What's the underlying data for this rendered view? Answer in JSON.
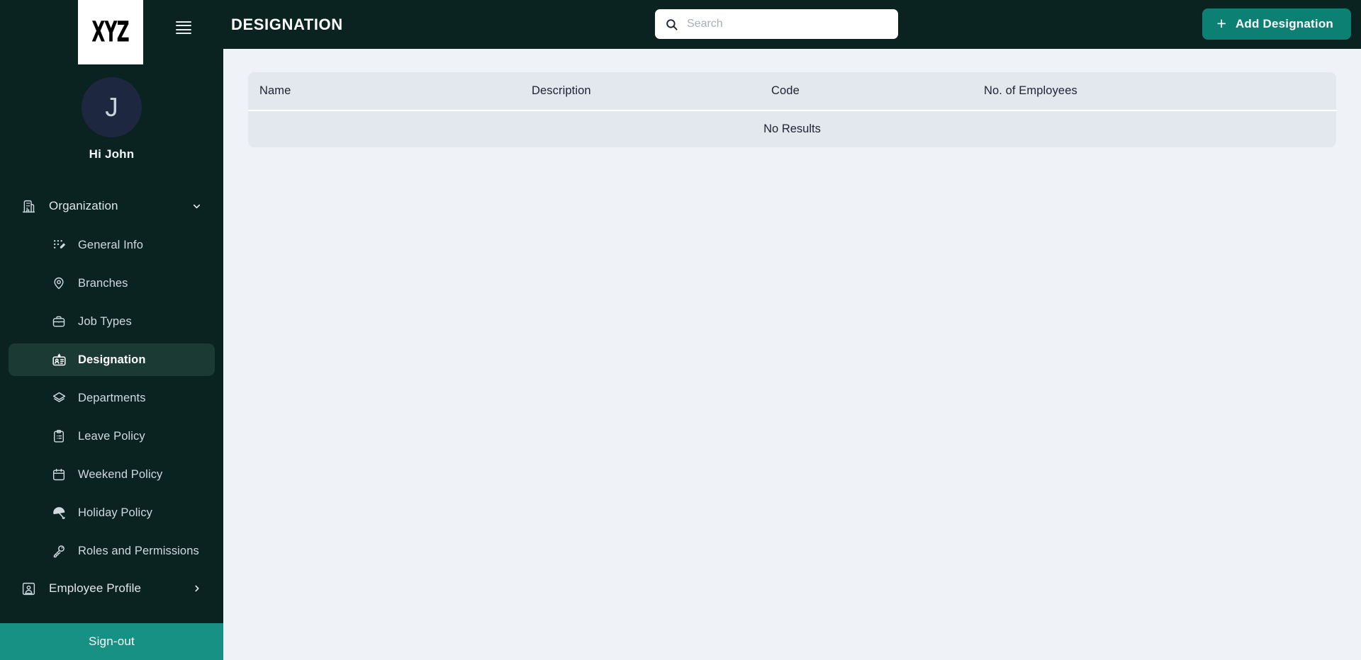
{
  "brand": {
    "logo_text": "XYZ",
    "menu_icon": "hamburger-icon"
  },
  "user": {
    "initial": "J",
    "greeting": "Hi John"
  },
  "sidebar": {
    "group": {
      "label": "Organization",
      "icon": "building-icon",
      "chevron": "chevron-down-icon",
      "expanded": true
    },
    "items": [
      {
        "label": "General Info",
        "icon": "dotted-grid-pencil-icon",
        "active": false
      },
      {
        "label": "Branches",
        "icon": "map-pin-icon",
        "active": false
      },
      {
        "label": "Job Types",
        "icon": "briefcase-icon",
        "active": false
      },
      {
        "label": "Designation",
        "icon": "id-badge-icon",
        "active": true
      },
      {
        "label": "Departments",
        "icon": "layers-icon",
        "active": false
      },
      {
        "label": "Leave Policy",
        "icon": "clipboard-list-icon",
        "active": false
      },
      {
        "label": "Weekend Policy",
        "icon": "calendar-icon",
        "active": false
      },
      {
        "label": "Holiday Policy",
        "icon": "beach-umbrella-icon",
        "active": false
      },
      {
        "label": "Roles and Permissions",
        "icon": "key-icon",
        "active": false
      }
    ],
    "employee_profile": {
      "label": "Employee Profile",
      "icon": "id-card-icon",
      "chevron": "chevron-right-icon"
    },
    "signout": {
      "label": "Sign-out"
    }
  },
  "header": {
    "title": "DESIGNATION",
    "search": {
      "placeholder": "Search",
      "value": "",
      "icon": "search-icon"
    },
    "add_button": {
      "label": "Add Designation",
      "icon": "plus-icon"
    }
  },
  "table": {
    "columns": [
      "Name",
      "Description",
      "Code",
      "No. of Employees"
    ],
    "rows": [],
    "empty_message": "No Results"
  },
  "colors": {
    "sidebar_bg": "#0a2320",
    "accent_teal": "#0d8074",
    "signout_teal": "#179184",
    "active_item_bg": "#1b3a34",
    "content_bg": "#eff2f7",
    "table_bg": "#e3e7ee",
    "avatar_bg": "#1e2740"
  }
}
